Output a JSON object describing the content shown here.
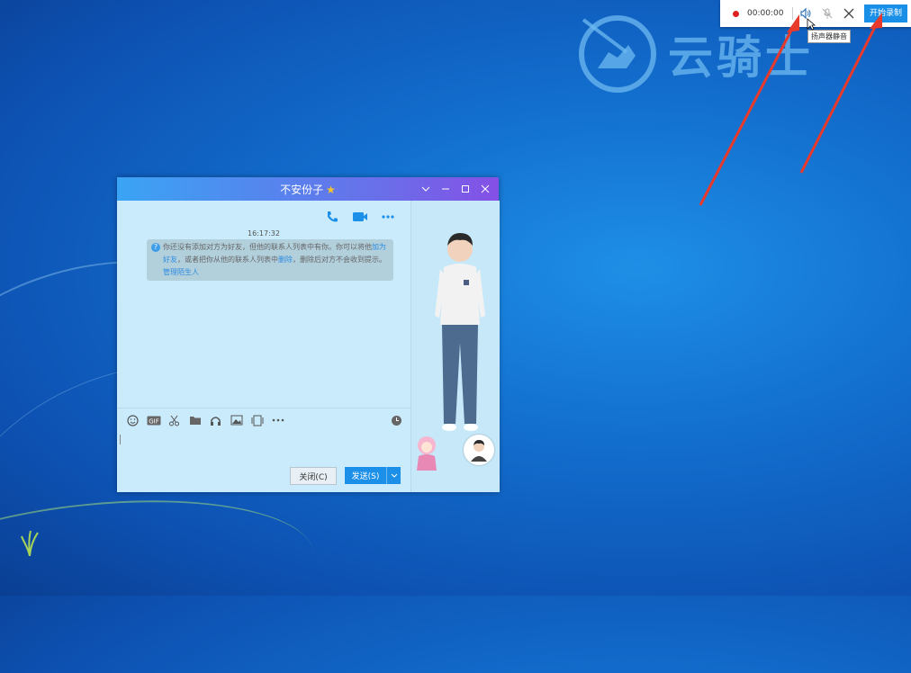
{
  "recorder": {
    "time": "00:00:00",
    "speaker_tooltip": "扬声器静音",
    "start_label": "开始录制"
  },
  "watermark": {
    "text": "云骑士"
  },
  "chat_window": {
    "title": "不安份子",
    "timestamp": "16:17:32",
    "system_message": {
      "part1": "你还没有添加对方为好友，但他的联系人列表中有你。你可以将他",
      "link_add": "加为好友",
      "part2": "，或者把你从他的联系人列表中",
      "link_delete": "删除",
      "part3": "，删除后对方不会收到提示。",
      "link_manage": "管理陌生人"
    },
    "close_label": "关闭(C)",
    "send_label": "发送(S)"
  },
  "colors": {
    "accent": "#1c8fe9",
    "title_gradient_start": "#3aa4f4",
    "title_gradient_end": "#8450e6",
    "record_dot": "#e02020",
    "arrow": "#e83a2c"
  },
  "icons": {
    "toolbar": [
      "emoji-icon",
      "gif-icon",
      "scissors-icon",
      "folder-icon",
      "music-icon",
      "image-icon",
      "screen-share-icon",
      "more-icon"
    ],
    "call": [
      "voice-call-icon",
      "video-call-icon",
      "more-icon"
    ]
  }
}
